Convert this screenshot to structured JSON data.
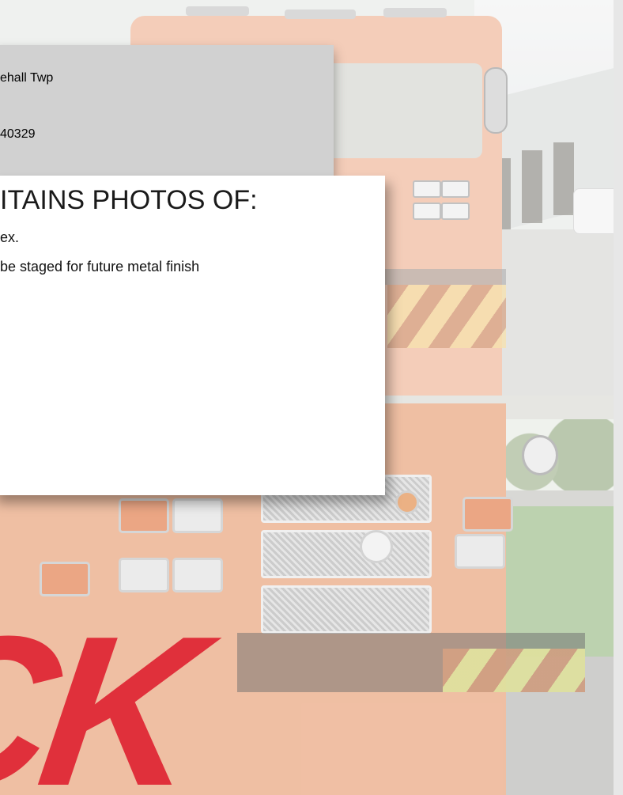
{
  "header": {
    "title_line": "ehall Twp",
    "number_line": "40329"
  },
  "content": {
    "heading": "ITAINS PHOTOS OF:",
    "items": [
      "ex.",
      "be staged for future metal finish"
    ]
  },
  "brand": {
    "wordmark": "ICK",
    "color": "#e0303b"
  },
  "colors": {
    "header_card": "#d1d1d1",
    "content_card": "#ffffff",
    "side_strip": "#e7e7e7"
  },
  "images": {
    "top_photo": "fire-truck-cab-front",
    "bottom_photo": "fire-truck-front-bumper-closeup"
  }
}
